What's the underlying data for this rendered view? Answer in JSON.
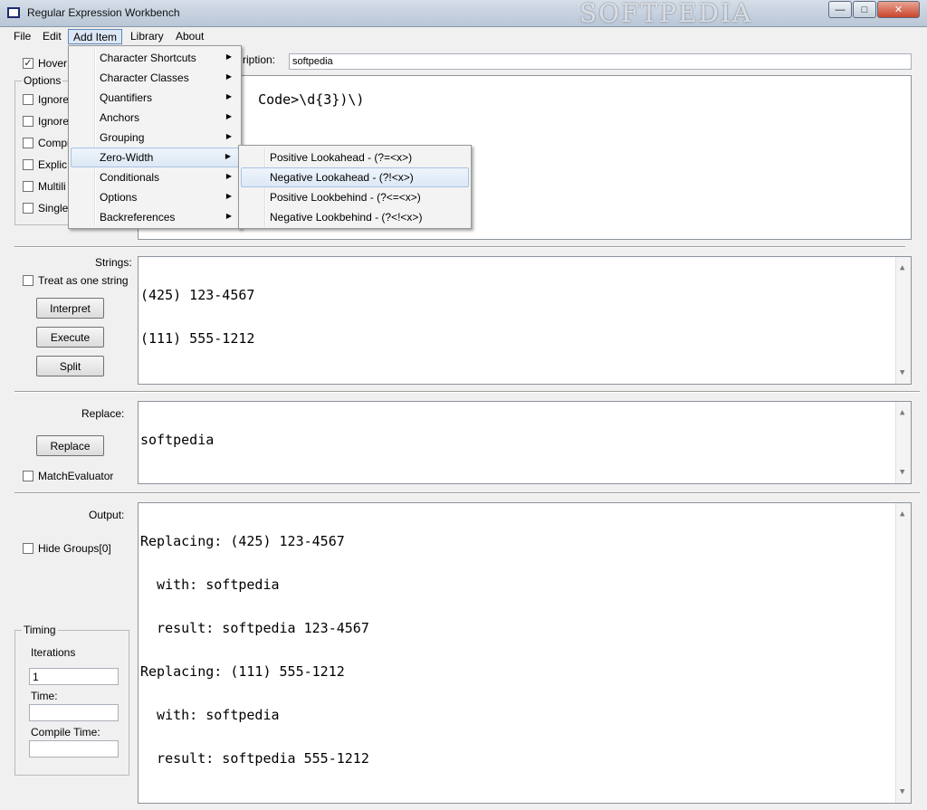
{
  "window": {
    "title": "Regular Expression Workbench",
    "watermark": "SOFTPEDIA",
    "controls": {
      "minimize": "—",
      "maximize": "□",
      "close": "✕"
    }
  },
  "menubar": [
    "File",
    "Edit",
    "Add Item",
    "Library",
    "About"
  ],
  "top": {
    "hover_label": "Hover",
    "hover_checked": "✓",
    "description_label": "ription:",
    "description_value": "softpedia",
    "regex_visible": "Code>\\d{3})\\)"
  },
  "options": {
    "title": "Options",
    "items": [
      "Ignore",
      "Ignore",
      "Compi",
      "Explic",
      "Multili",
      "Single"
    ]
  },
  "add_item_menu": {
    "items": [
      "Character Shortcuts",
      "Character Classes",
      "Quantifiers",
      "Anchors",
      "Grouping",
      "Zero-Width",
      "Conditionals",
      "Options",
      "Backreferences"
    ],
    "highlighted": "Zero-Width"
  },
  "zero_width_submenu": {
    "items": [
      "Positive Lookahead - (?=<x>)",
      "Negative Lookahead - (?!<x>)",
      "Positive Lookbehind - (?<=<x>)",
      "Negative Lookbehind - (?<!<x>)"
    ],
    "highlighted": "Negative Lookahead - (?!<x>)"
  },
  "strings": {
    "label": "Strings:",
    "treat_as_one": "Treat as one string",
    "buttons": [
      "Interpret",
      "Execute",
      "Split"
    ],
    "lines": [
      "(425) 123-4567",
      "(111) 555-1212"
    ]
  },
  "replace": {
    "label": "Replace:",
    "button": "Replace",
    "match_evaluator": "MatchEvaluator",
    "value": "softpedia"
  },
  "output": {
    "label": "Output:",
    "hide_groups": "Hide Groups[0]",
    "lines": [
      "Replacing: (425) 123-4567",
      "  with: softpedia",
      "  result: softpedia 123-4567",
      "Replacing: (111) 555-1212",
      "  with: softpedia",
      "  result: softpedia 555-1212"
    ]
  },
  "timing": {
    "title": "Timing",
    "iterations_label": "Iterations",
    "iterations_value": "1",
    "time_label": "Time:",
    "time_value": "",
    "compile_label": "Compile Time:",
    "compile_value": ""
  },
  "scroll": {
    "up": "▲",
    "down": "▼"
  },
  "menu_arrow": "▶"
}
